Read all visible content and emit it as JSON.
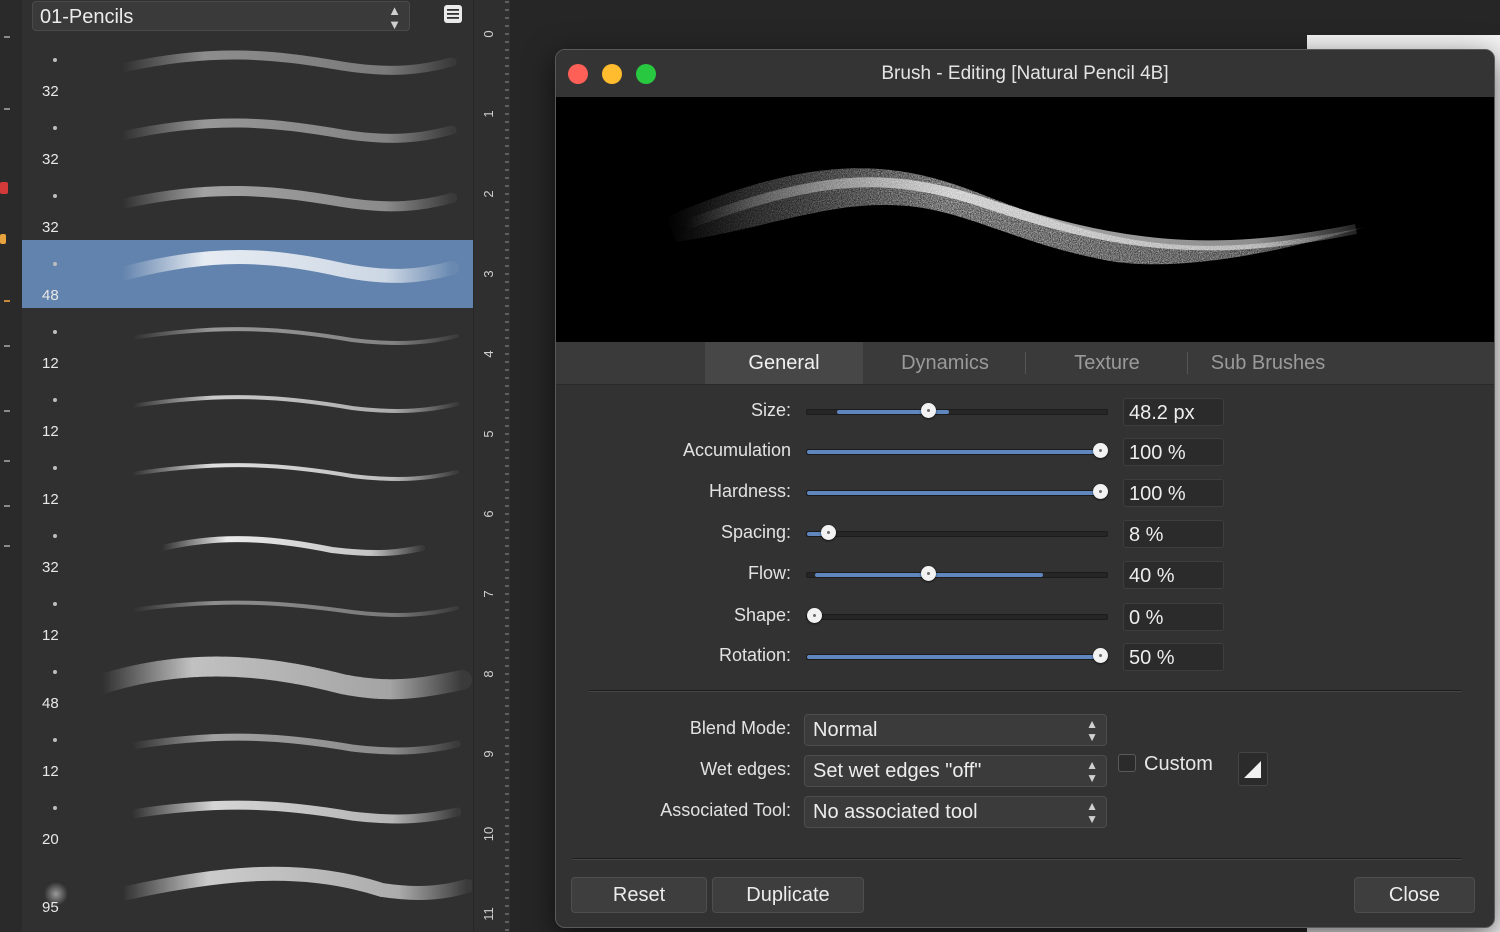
{
  "brush_panel": {
    "category": "01-Pencils",
    "brushes": [
      {
        "size": "32",
        "selected": false
      },
      {
        "size": "32",
        "selected": false
      },
      {
        "size": "32",
        "selected": false
      },
      {
        "size": "48",
        "selected": true
      },
      {
        "size": "12",
        "selected": false
      },
      {
        "size": "12",
        "selected": false
      },
      {
        "size": "12",
        "selected": false
      },
      {
        "size": "32",
        "selected": false
      },
      {
        "size": "12",
        "selected": false
      },
      {
        "size": "48",
        "selected": false
      },
      {
        "size": "12",
        "selected": false
      },
      {
        "size": "20",
        "selected": false
      },
      {
        "size": "95",
        "selected": false
      }
    ]
  },
  "ruler": {
    "labels": [
      "0",
      "1",
      "2",
      "3",
      "4",
      "5",
      "6",
      "7",
      "8",
      "9",
      "10",
      "11"
    ]
  },
  "dialog": {
    "title": "Brush - Editing [Natural Pencil 4B]",
    "tabs": [
      "General",
      "Dynamics",
      "Texture",
      "Sub Brushes"
    ],
    "active_tab": "General",
    "properties": [
      {
        "label": "Size:",
        "value": "48.2 px",
        "fraction": 0.4
      },
      {
        "label": "Accumulation",
        "value": "100 %",
        "fraction": 1.0
      },
      {
        "label": "Hardness:",
        "value": "100 %",
        "fraction": 1.0
      },
      {
        "label": "Spacing:",
        "value": "8 %",
        "fraction": 0.05
      },
      {
        "label": "Flow:",
        "value": "40 %",
        "fraction": 0.4
      },
      {
        "label": "Shape:",
        "value": "0 %",
        "fraction": 0.0
      },
      {
        "label": "Rotation:",
        "value": "50 %",
        "fraction": 1.0
      }
    ],
    "blend_mode_label": "Blend Mode:",
    "blend_mode_value": "Normal",
    "wet_edges_label": "Wet edges:",
    "wet_edges_value": "Set wet edges \"off\"",
    "custom_label": "Custom",
    "custom_checked": false,
    "associated_tool_label": "Associated Tool:",
    "associated_tool_value": "No associated tool",
    "reset_label": "Reset",
    "duplicate_label": "Duplicate",
    "close_label": "Close"
  },
  "colors": {
    "accent": "#5f86bd",
    "selection": "#6283ad",
    "close": "#fe5f57",
    "minimize": "#febc2e",
    "zoom": "#28c840"
  }
}
